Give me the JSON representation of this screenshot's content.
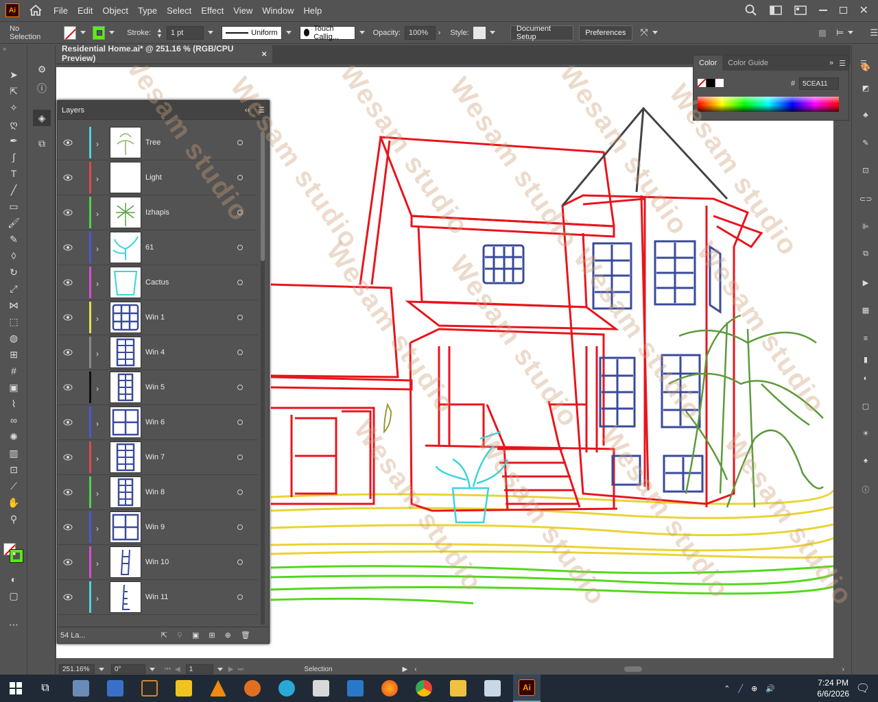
{
  "menubar": {
    "logo": "Ai",
    "items": [
      "File",
      "Edit",
      "Object",
      "Type",
      "Select",
      "Effect",
      "View",
      "Window",
      "Help"
    ]
  },
  "controlbar": {
    "selection": "No Selection",
    "stroke_label": "Stroke:",
    "stroke_value": "1 pt",
    "profile": "Uniform",
    "brush": "Touch Callig...",
    "opacity_label": "Opacity:",
    "opacity_value": "100%",
    "style_label": "Style:",
    "document_setup": "Document Setup",
    "preferences": "Preferences"
  },
  "document": {
    "tab_title": "Residential Home.ai* @ 251.16 % (RGB/CPU Preview)",
    "close": "×"
  },
  "layers_panel": {
    "title": "Layers",
    "count": "54 La...",
    "layers": [
      {
        "name": "Tree",
        "color": "#4fd4e0"
      },
      {
        "name": "Light",
        "color": "#e04a4a"
      },
      {
        "name": "Izhapis",
        "color": "#4cd44c"
      },
      {
        "name": "61",
        "color": "#4a58d8"
      },
      {
        "name": "Cactus",
        "color": "#e04ad8"
      },
      {
        "name": "Win 1",
        "color": "#e8e04a"
      },
      {
        "name": "Win 4",
        "color": "#8a8a8a"
      },
      {
        "name": "Win 5",
        "color": "#101010"
      },
      {
        "name": "Win 6",
        "color": "#4a58d8"
      },
      {
        "name": "Win 7",
        "color": "#e04a4a"
      },
      {
        "name": "Win 8",
        "color": "#4cd44c"
      },
      {
        "name": "Win 9",
        "color": "#4a58d8"
      },
      {
        "name": "Win 10",
        "color": "#e04ad8"
      },
      {
        "name": "Win 11",
        "color": "#4fd4e0"
      }
    ]
  },
  "color_panel": {
    "tabs": [
      "Color",
      "Color Guide"
    ],
    "hash": "#",
    "hex": "5CEA11"
  },
  "statusbar": {
    "zoom": "251.16%",
    "rotation": "0°",
    "artboard": "1",
    "tool": "Selection"
  },
  "taskbar": {
    "time": "7:24 PM",
    "date": "6/6/2026"
  },
  "watermark": "Wesam studio"
}
